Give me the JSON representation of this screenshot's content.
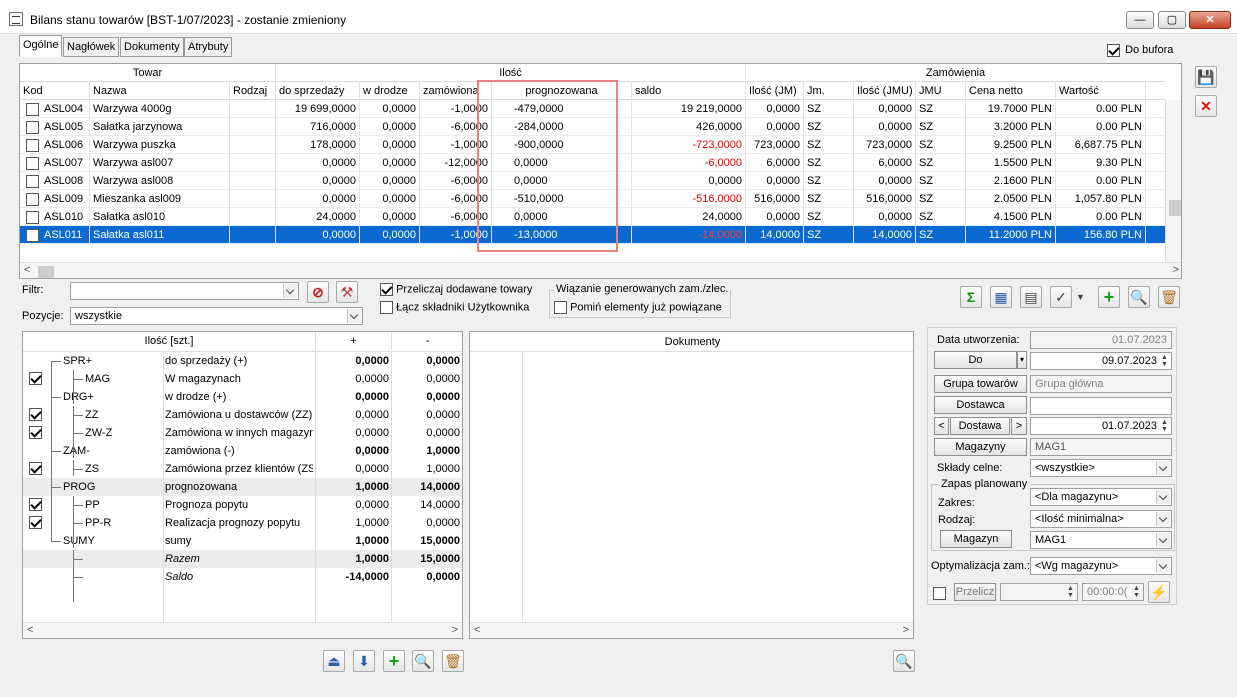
{
  "window": {
    "title": "Bilans stanu towarów [BST-1/07/2023] - zostanie zmieniony",
    "min": "—",
    "max": "▢",
    "close": "✕"
  },
  "tabs": [
    "Ogólne",
    "Nagłówek",
    "Dokumenty",
    "Atrybuty"
  ],
  "do_bufora": "Do bufora",
  "grid": {
    "group_headers": {
      "towar": "Towar",
      "ilosc": "Ilość",
      "zamowienia": "Zamówienia"
    },
    "columns": [
      "Kod",
      "Nazwa",
      "Rodzaj",
      "do sprzedaży",
      "w drodze",
      "zamówiona",
      "prognozowana",
      "saldo",
      "Ilość (JM)",
      "Jm.",
      "Ilość (JMU)",
      "JMU",
      "Cena netto",
      "Wartość"
    ],
    "rows": [
      {
        "kod": "ASL004",
        "nazwa": "Warzywa 4000g",
        "rodzaj": "",
        "sprz": "19 699,0000",
        "droga": "0,0000",
        "zam": "-1,0000",
        "prog": "-479,0000",
        "saldo": "19 219,0000",
        "ijm": "0,0000",
        "jm": "SZ",
        "ijmu": "0,0000",
        "jmu": "SZ",
        "cena": "19.7000 PLN",
        "wart": "0.00 PLN",
        "saldo_red": false
      },
      {
        "kod": "ASL005",
        "nazwa": "Sałatka jarzynowa",
        "rodzaj": "",
        "sprz": "716,0000",
        "droga": "0,0000",
        "zam": "-6,0000",
        "prog": "-284,0000",
        "saldo": "426,0000",
        "ijm": "0,0000",
        "jm": "SZ",
        "ijmu": "0,0000",
        "jmu": "SZ",
        "cena": "3.2000 PLN",
        "wart": "0.00 PLN",
        "saldo_red": false
      },
      {
        "kod": "ASL006",
        "nazwa": "Warzywa puszka",
        "rodzaj": "",
        "sprz": "178,0000",
        "droga": "0,0000",
        "zam": "-1,0000",
        "prog": "-900,0000",
        "saldo": "-723,0000",
        "ijm": "723,0000",
        "jm": "SZ",
        "ijmu": "723,0000",
        "jmu": "SZ",
        "cena": "9.2500 PLN",
        "wart": "6,687.75 PLN",
        "saldo_red": true
      },
      {
        "kod": "ASL007",
        "nazwa": "Warzywa asl007",
        "rodzaj": "",
        "sprz": "0,0000",
        "droga": "0,0000",
        "zam": "-12,0000",
        "prog": "0,0000",
        "saldo": "-6,0000",
        "ijm": "6,0000",
        "jm": "SZ",
        "ijmu": "6,0000",
        "jmu": "SZ",
        "cena": "1.5500 PLN",
        "wart": "9.30 PLN",
        "saldo_red": true
      },
      {
        "kod": "ASL008",
        "nazwa": "Warzywa asl008",
        "rodzaj": "",
        "sprz": "0,0000",
        "droga": "0,0000",
        "zam": "-6,0000",
        "prog": "0,0000",
        "saldo": "0,0000",
        "ijm": "0,0000",
        "jm": "SZ",
        "ijmu": "0,0000",
        "jmu": "SZ",
        "cena": "2.1600 PLN",
        "wart": "0.00 PLN",
        "saldo_red": false
      },
      {
        "kod": "ASL009",
        "nazwa": "Mieszanka asl009",
        "rodzaj": "",
        "sprz": "0,0000",
        "droga": "0,0000",
        "zam": "-6,0000",
        "prog": "-510,0000",
        "saldo": "-516,0000",
        "ijm": "516,0000",
        "jm": "SZ",
        "ijmu": "516,0000",
        "jmu": "SZ",
        "cena": "2.0500 PLN",
        "wart": "1,057.80 PLN",
        "saldo_red": true
      },
      {
        "kod": "ASL010",
        "nazwa": "Sałatka asl010",
        "rodzaj": "",
        "sprz": "24,0000",
        "droga": "0,0000",
        "zam": "-6,0000",
        "prog": "0,0000",
        "saldo": "24,0000",
        "ijm": "0,0000",
        "jm": "SZ",
        "ijmu": "0,0000",
        "jmu": "SZ",
        "cena": "4.1500 PLN",
        "wart": "0.00 PLN",
        "saldo_red": false
      },
      {
        "kod": "ASL011",
        "nazwa": "Sałatka asl011",
        "rodzaj": "",
        "sprz": "0,0000",
        "droga": "0,0000",
        "zam": "-1,0000",
        "prog": "-13,0000",
        "saldo": "-14,0000",
        "ijm": "14,0000",
        "jm": "SZ",
        "ijmu": "14,0000",
        "jmu": "SZ",
        "cena": "11.2000 PLN",
        "wart": "156.80 PLN",
        "saldo_red": true
      }
    ]
  },
  "filter": {
    "label": "Filtr:",
    "value": "",
    "pozycje_label": "Pozycje:",
    "pozycje_value": "wszystkie",
    "przeliczaj": "Przeliczaj dodawane towary",
    "lacz": "Łącz składniki Użytkownika",
    "wiazanie_title": "Wiązanie generowanych zam./zlec.",
    "pomin": "Pomiń elementy już powiązane"
  },
  "tree": {
    "headers": {
      "ilosc": "Ilość [szt.]",
      "plus": "+",
      "minus": "-"
    },
    "rows": [
      {
        "code": "SPR+",
        "level": 0,
        "checked": null,
        "desc": "do sprzedaży (+)",
        "p": "0,0000",
        "m": "0,0000",
        "bold": true,
        "shade": false,
        "italic": false
      },
      {
        "code": "MAG",
        "level": 1,
        "checked": true,
        "desc": "W magazynach",
        "p": "0,0000",
        "m": "0,0000",
        "bold": false,
        "shade": false,
        "italic": false
      },
      {
        "code": "DRG+",
        "level": 0,
        "checked": null,
        "desc": "w drodze (+)",
        "p": "0,0000",
        "m": "0,0000",
        "bold": true,
        "shade": false,
        "italic": false
      },
      {
        "code": "ZZ",
        "level": 1,
        "checked": true,
        "desc": "Zamówiona u dostawców (ZZ)",
        "p": "0,0000",
        "m": "0,0000",
        "bold": false,
        "shade": false,
        "italic": false
      },
      {
        "code": "ZW-Z",
        "level": 1,
        "checked": true,
        "desc": "Zamówiona w innych magazyna",
        "p": "0,0000",
        "m": "0,0000",
        "bold": false,
        "shade": false,
        "italic": false
      },
      {
        "code": "ZAM-",
        "level": 0,
        "checked": null,
        "desc": "zamówiona (-)",
        "p": "0,0000",
        "m": "1,0000",
        "bold": true,
        "shade": false,
        "italic": false
      },
      {
        "code": "ZS",
        "level": 1,
        "checked": true,
        "desc": "Zamówiona przez klientów (ZS)",
        "p": "0,0000",
        "m": "1,0000",
        "bold": false,
        "shade": false,
        "italic": false
      },
      {
        "code": "PROG",
        "level": 0,
        "checked": null,
        "desc": "prognozowana",
        "p": "1,0000",
        "m": "14,0000",
        "bold": true,
        "shade": true,
        "italic": false
      },
      {
        "code": "PP",
        "level": 1,
        "checked": true,
        "desc": "Prognoza popytu",
        "p": "0,0000",
        "m": "14,0000",
        "bold": false,
        "shade": false,
        "italic": false
      },
      {
        "code": "PP-R",
        "level": 1,
        "checked": true,
        "desc": "Realizacja prognozy popytu",
        "p": "1,0000",
        "m": "0,0000",
        "bold": false,
        "shade": false,
        "italic": false
      },
      {
        "code": "SUMY",
        "level": 0,
        "checked": null,
        "desc": "sumy",
        "p": "1,0000",
        "m": "15,0000",
        "bold": true,
        "shade": false,
        "italic": false
      },
      {
        "code": "",
        "level": 1,
        "checked": null,
        "desc": "Razem",
        "p": "1,0000",
        "m": "15,0000",
        "bold": true,
        "shade": true,
        "italic": true
      },
      {
        "code": "",
        "level": 1,
        "checked": null,
        "desc": "Saldo",
        "p": "-14,0000",
        "m": "0,0000",
        "bold": true,
        "shade": false,
        "italic": true
      }
    ]
  },
  "documents": {
    "header": "Dokumenty"
  },
  "right": {
    "data_utworzenia_label": "Data utworzenia:",
    "data_utworzenia": "01.07.2023",
    "do_label": "Do",
    "do_value": "09.07.2023",
    "grupa_label": "Grupa towarów",
    "grupa_value": "Grupa główna",
    "dostawca_label": "Dostawca",
    "dostawca_value": "",
    "dostawa_label": "Dostawa",
    "dostawa_value": "01.07.2023",
    "magazyny_label": "Magazyny",
    "magazyny_value": "MAG1",
    "sklady_label": "Składy celne:",
    "sklady_value": "<wszystkie>",
    "zapas_title": "Zapas planowany",
    "zakres_label": "Zakres:",
    "zakres_value": "<Dla magazynu>",
    "rodzaj_label": "Rodzaj:",
    "rodzaj_value": "<Ilość minimalna>",
    "magazyn_label": "Magazyn",
    "magazyn_value": "MAG1",
    "optym_label": "Optymalizacja zam.:",
    "optym_value": "<Wg magazynu>",
    "przelicz_label": "Przelicz",
    "time_value": "00:00:0("
  }
}
